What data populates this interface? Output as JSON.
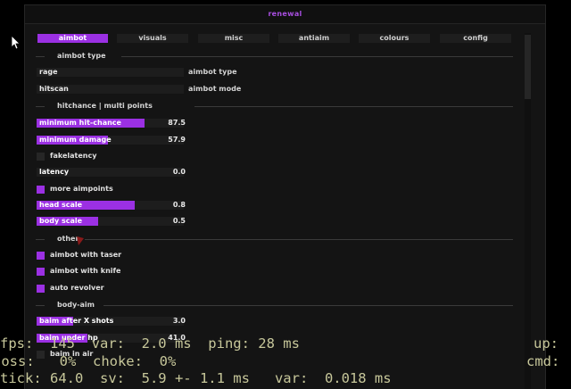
{
  "window": {
    "title": "renewal"
  },
  "tabs": [
    {
      "label": "aimbot",
      "active": true
    },
    {
      "label": "visuals",
      "active": false
    },
    {
      "label": "misc",
      "active": false
    },
    {
      "label": "antiaim",
      "active": false
    },
    {
      "label": "colours",
      "active": false
    },
    {
      "label": "config",
      "active": false
    }
  ],
  "sections": {
    "aimbot_type": "aimbot type",
    "hitchance": "hitchance | multi points",
    "other": "other",
    "body_aim": "body-aim"
  },
  "aimbot_type": {
    "type_value": "rage",
    "type_label": "aimbot type",
    "mode_value": "hitscan",
    "mode_label": "aimbot mode"
  },
  "sliders": {
    "min_hitchance": {
      "label": "minimum hit-chance",
      "value": "87.5",
      "fraction": 0.875
    },
    "min_damage": {
      "label": "minimum damage",
      "value": "57.9",
      "fraction": 0.579
    },
    "latency": {
      "label": "latency",
      "value": "0.0",
      "fraction": 0.0
    },
    "head_scale": {
      "label": "head scale",
      "value": "0.8",
      "fraction": 0.8
    },
    "body_scale": {
      "label": "body scale",
      "value": "0.5",
      "fraction": 0.5
    },
    "baim_after_shots": {
      "label": "baim after X shots",
      "value": "3.0",
      "fraction": 0.3
    },
    "baim_under_hp": {
      "label": "baim under hp",
      "value": "41.0",
      "fraction": 0.41
    }
  },
  "checkboxes": {
    "fakelatency": {
      "label": "fakelatency",
      "checked": false
    },
    "more_aimpoints": {
      "label": "more aimpoints",
      "checked": true
    },
    "aimbot_with_taser": {
      "label": "aimbot with taser",
      "checked": true
    },
    "aimbot_with_knife": {
      "label": "aimbot with knife",
      "checked": true
    },
    "auto_revolver": {
      "label": "auto revolver",
      "checked": true
    },
    "baim_in_air": {
      "label": "baim in air",
      "checked": false
    }
  },
  "netgraph": {
    "line1": "fps:  145  var:  2.0 ms  ping: 28 ms",
    "line1_right": "up:",
    "line2": " oss:   0%  choke:  0%",
    "line2_right": "cmd:",
    "line3": "tick: 64.0  sv:  5.9 +- 1.1 ms   var:  0.018 ms"
  },
  "colors": {
    "accent": "#9b30e3",
    "title": "#a84ee0",
    "background": "#141414",
    "netgraph_text": "#c7c79a"
  }
}
